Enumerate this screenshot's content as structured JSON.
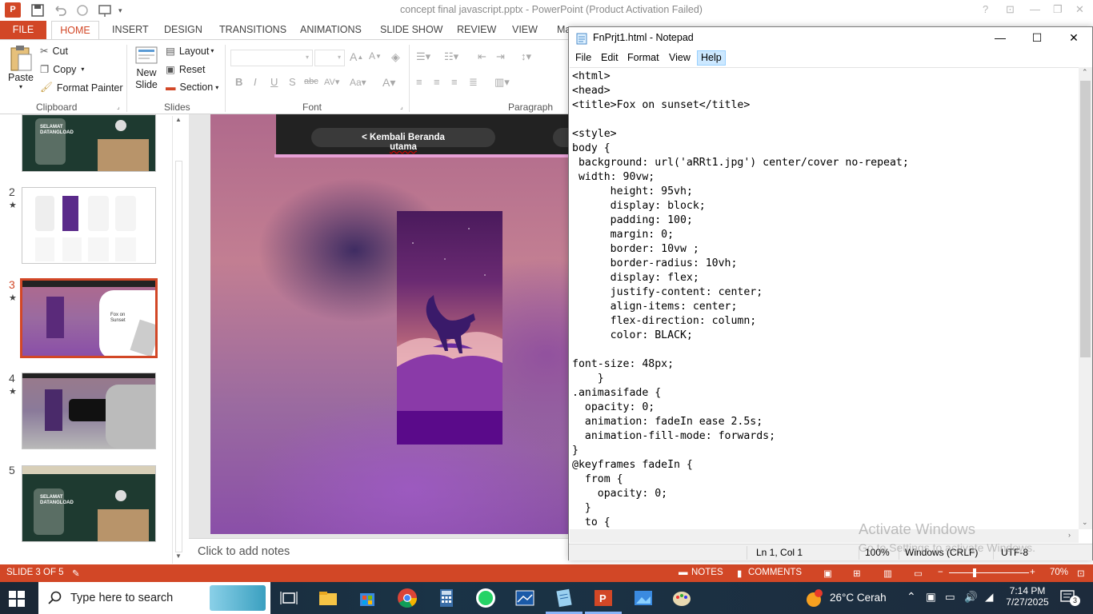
{
  "powerpoint": {
    "title": "concept final javascript.pptx - PowerPoint (Product Activation Failed)",
    "tabs": [
      "FILE",
      "HOME",
      "INSERT",
      "DESIGN",
      "TRANSITIONS",
      "ANIMATIONS",
      "SLIDE SHOW",
      "REVIEW",
      "VIEW",
      "Ma"
    ],
    "ribbon": {
      "clipboard": {
        "paste": "Paste",
        "cut": "Cut",
        "copy": "Copy",
        "format_painter": "Format Painter",
        "label": "Clipboard"
      },
      "slides": {
        "new_slide_1": "New",
        "new_slide_2": "Slide",
        "layout": "Layout",
        "reset": "Reset",
        "section": "Section",
        "label": "Slides"
      },
      "font": {
        "label": "Font"
      },
      "paragraph": {
        "label": "Paragraph"
      }
    },
    "thumbnails": [
      {
        "num": "",
        "star": ""
      },
      {
        "num": "2",
        "star": "★"
      },
      {
        "num": "3",
        "star": "★"
      },
      {
        "num": "4",
        "star": "★"
      },
      {
        "num": "5",
        "star": ""
      }
    ],
    "slide": {
      "nav_label_1": "< Kembali Beranda",
      "nav_label_2": "utama"
    },
    "notes_placeholder": "Click to add notes",
    "status": {
      "slide_info": "SLIDE 3 OF 5",
      "notes": "NOTES",
      "comments": "COMMENTS",
      "zoom": "70%"
    }
  },
  "notepad": {
    "title": "FnPrjt1.html - Notepad",
    "menu": [
      "File",
      "Edit",
      "Format",
      "View",
      "Help"
    ],
    "content": "<html>\n<head>\n<title>Fox on sunset</title>\n\n<style>\nbody {\n background: url('aRRt1.jpg') center/cover no-repeat;\n width: 90vw;\n      height: 95vh;\n      display: block;\n      padding: 100;\n      margin: 0;\n      border: 10vw ;\n      border-radius: 10vh;\n      display: flex;\n      justify-content: center;\n      align-items: center;\n      flex-direction: column;\n      color: BLACK;\n\nfont-size: 48px;\n    }\n.animasifade {\n  opacity: 0;\n  animation: fadeIn ease 2.5s;\n  animation-fill-mode: forwards;\n}\n@keyframes fadeIn {\n  from {\n    opacity: 0;\n  }\n  to {",
    "status": {
      "position": "Ln 1, Col 1",
      "zoom": "100%",
      "line_ending": "Windows (CRLF)",
      "encoding": "UTF-8"
    }
  },
  "watermark": {
    "line1": "Activate Windows",
    "line2": "Go to Settings to activate Windows."
  },
  "taskbar": {
    "search_placeholder": "Type here to search",
    "weather": "26°C  Cerah",
    "time": "7:14 PM",
    "date": "7/27/2025",
    "notifications": "3"
  },
  "colors": {
    "ppt_accent": "#d24726",
    "taskbar": "#1b2735"
  }
}
